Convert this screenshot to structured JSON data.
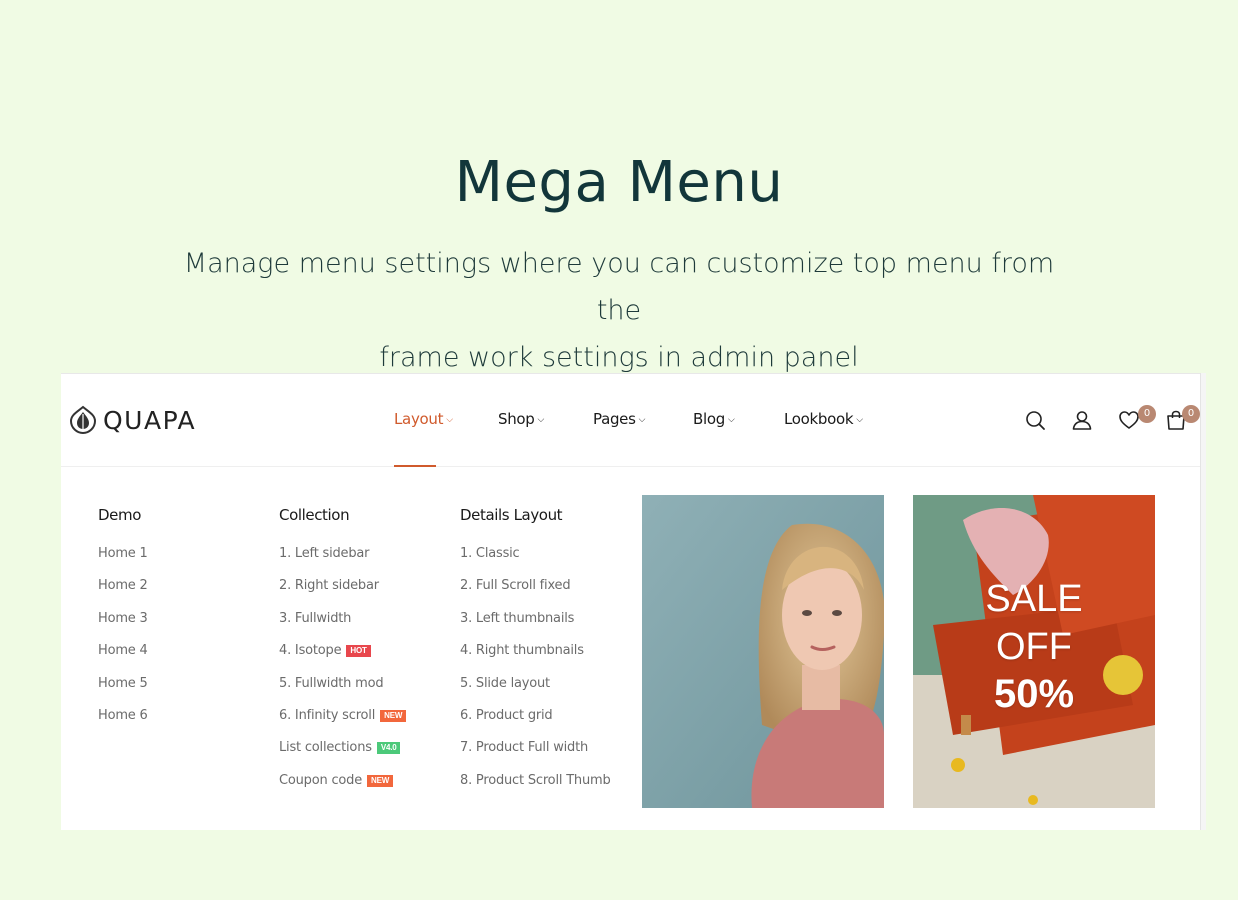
{
  "hero": {
    "title": "Mega Menu",
    "subtitle_line1": "Manage menu settings where you can customize top menu from the",
    "subtitle_line2": "frame work settings in admin panel"
  },
  "header": {
    "logo_text": "QUAPA",
    "nav": [
      {
        "label": "Layout",
        "active": true
      },
      {
        "label": "Shop"
      },
      {
        "label": "Pages"
      },
      {
        "label": "Blog"
      },
      {
        "label": "Lookbook"
      }
    ],
    "icons": [
      "search-icon",
      "user-icon",
      "heart-icon",
      "cart-icon"
    ],
    "wishlist_count": "0",
    "cart_count": "0"
  },
  "mega_menu": {
    "demo": {
      "heading": "Demo",
      "items": [
        "Home 1",
        "Home 2",
        "Home 3",
        "Home 4",
        "Home 5",
        "Home 6"
      ]
    },
    "collection": {
      "heading": "Collection",
      "items": [
        {
          "label": "1. Left sidebar"
        },
        {
          "label": "2. Right sidebar"
        },
        {
          "label": "3. Fullwidth"
        },
        {
          "label": "4. Isotope",
          "tag": "HOT"
        },
        {
          "label": "5. Fullwidth mod"
        },
        {
          "label": "6. Infinity scroll",
          "tag": "NEW"
        },
        {
          "label": "List collections",
          "tag": "V4.0"
        },
        {
          "label": "Coupon code",
          "tag": "NEW"
        }
      ]
    },
    "details": {
      "heading": "Details Layout",
      "items": [
        "1. Classic",
        "2. Full Scroll fixed",
        "3. Left thumbnails",
        "4. Right thumbnails",
        "5. Slide layout",
        "6. Product grid",
        "7. Product Full width",
        "8. Product Scroll Thumb"
      ]
    },
    "sale_banner": {
      "line1": "SALE",
      "line2": "OFF",
      "line3": "50%"
    }
  },
  "colors": {
    "background": "#f0fbe4",
    "accent": "#d05a2c",
    "tag_hot": "#e8474d",
    "tag_new": "#f2673c",
    "tag_version": "#4cc97a",
    "badge": "#b98872"
  }
}
